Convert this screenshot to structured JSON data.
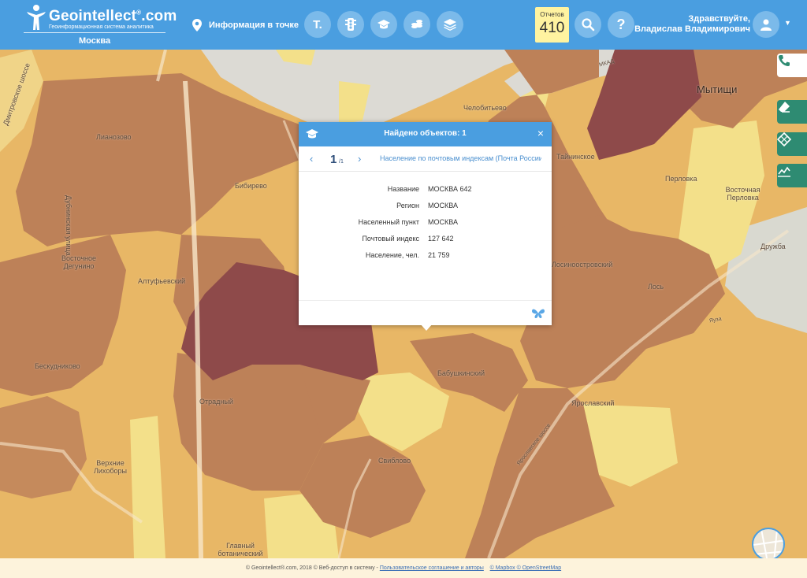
{
  "app": {
    "logo_title": "Geointellect",
    "logo_reg": "®",
    "logo_domain": ".com",
    "logo_subtitle": "Геоинформационная система аналитика",
    "city": "Москва"
  },
  "toolbar": {
    "info_point_label": "Информация в точке",
    "text_button_label": "T.",
    "reports_label": "Отчетов",
    "reports_count": "410",
    "help_label": "?"
  },
  "user": {
    "greeting_line1": "Здравствуйте,",
    "greeting_line2": "Владислав Владимирович"
  },
  "popup": {
    "title": "Найдено объектов: 1",
    "close_label": "×",
    "page_current": "1",
    "page_total": "/1",
    "prev_label": "‹",
    "next_label": "›",
    "layer_name": "Население по почтовым индексам (Почта России)",
    "fields": [
      {
        "key": "Название",
        "value": "МОСКВА 642"
      },
      {
        "key": "Регион",
        "value": "МОСКВА"
      },
      {
        "key": "Населенный пункт",
        "value": "МОСКВА"
      },
      {
        "key": "Почтовый индекс",
        "value": "127 642"
      },
      {
        "key": "Население, чел.",
        "value": "21 759"
      }
    ]
  },
  "map_labels": {
    "lianozovo": "Лианозово",
    "bibirevo": "Бибирево",
    "vostochnoe_degunino": "Восточное Дегунино",
    "altufevskiy": "Алтуфьевский",
    "beskudnikovo": "Бескудниково",
    "otradnyy": "Отрадный",
    "sviblovo": "Свиблово",
    "verkhnie_likhobory": "Верхние Лихоборы",
    "glavnyy_botanicheskiy": "Главный ботанический",
    "babushkinskiy": "Бабушкинский",
    "yaroslavskiy": "Ярославский",
    "los": "Лось",
    "losinoostrovskiy": "Лосиноостровский",
    "taininskoe": "Тайнинское",
    "perlovka": "Перловка",
    "vostochnaya_perlovka": "Восточная Перловка",
    "druzhba": "Дружба",
    "mytishchi": "Мытищи",
    "chelobitevo": "Челобитьево",
    "dmitrovskoe_shosse": "Дмитровское шоссе",
    "dubninskaya": "Дубнинская улица",
    "yaroslavskoe_shosse": "Ярославское шоссе",
    "mkad": "МКАД",
    "yauza": "Яуза"
  },
  "footer": {
    "copyright": "© Geointellect®.com, 2018 © Веб-доступ в систему - ",
    "terms_link": "Пользовательское соглашение и авторы",
    "mapbox_link": "© Mapbox © OpenStreetMap"
  },
  "colors": {
    "header_blue": "#4a9ee0",
    "choropleth_low": "#f3e08a",
    "choropleth_mid_low": "#eec56e",
    "choropleth_mid": "#e8b766",
    "choropleth_high": "#bd8158",
    "choropleth_max": "#8e4a4a",
    "side_button_green": "#2e8b72"
  }
}
